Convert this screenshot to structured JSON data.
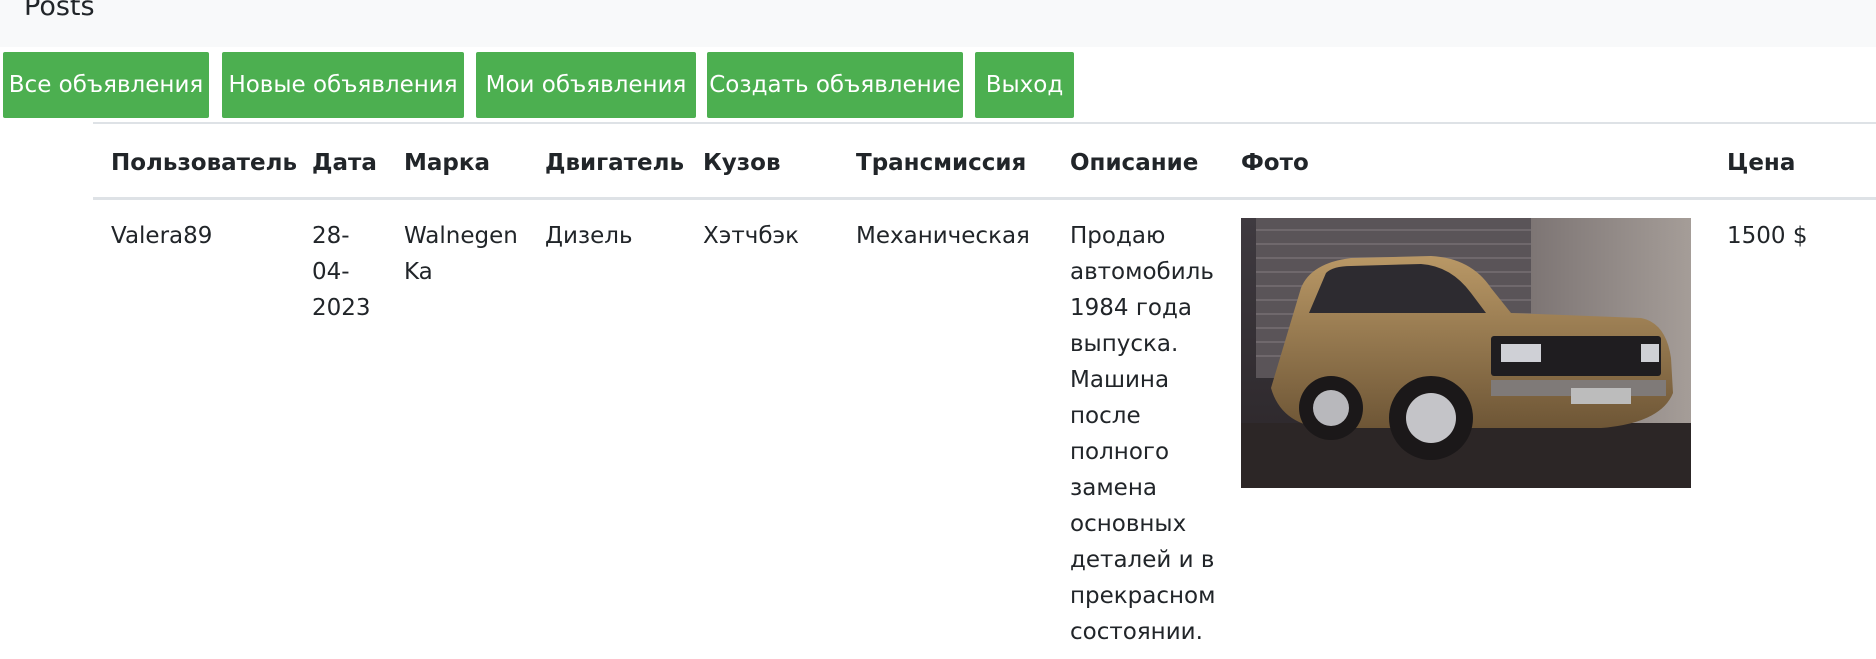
{
  "app": {
    "brand": "Posts"
  },
  "nav": {
    "buttons": [
      {
        "label": "Все объявления"
      },
      {
        "label": "Новые объявления"
      },
      {
        "label": "Мои объявления"
      },
      {
        "label": "Создать объявление"
      },
      {
        "label": "Выход"
      }
    ],
    "accent_color": "#4caf50"
  },
  "table": {
    "headers": [
      "Пользователь",
      "Дата",
      "Марка",
      "Двигатель",
      "Кузов",
      "Трансмиссия",
      "Описание",
      "Фото",
      "Цена"
    ],
    "rows": [
      {
        "user": "Valera89",
        "date_lines": [
          "28-",
          "04-",
          "2023"
        ],
        "brand_lines": [
          "Walnegen",
          "Ka"
        ],
        "engine": "Дизель",
        "body": "Хэтчбэк",
        "transmission": "Механическая",
        "description_lines": [
          "Продаю",
          "автомобиль",
          "1984 года",
          "выпуска.",
          "Машина",
          "после",
          "полного",
          "замена",
          "основных",
          "деталей и в",
          "прекрасном",
          "состоянии."
        ],
        "photo_icon": "car-photo",
        "price": "1500 $"
      }
    ]
  }
}
